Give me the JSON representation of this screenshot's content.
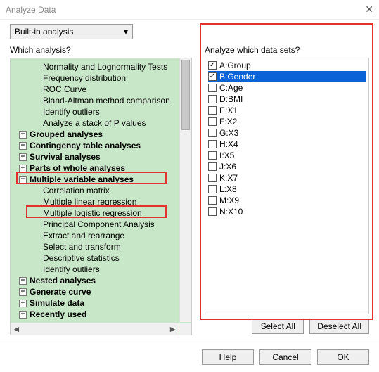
{
  "window": {
    "title": "Analyze Data"
  },
  "dropdown": {
    "value": "Built-in analysis"
  },
  "left": {
    "question": "Which analysis?",
    "tree": [
      {
        "indent": 1,
        "label": "Normality and Lognormality Tests"
      },
      {
        "indent": 1,
        "label": "Frequency distribution"
      },
      {
        "indent": 1,
        "label": "ROC Curve"
      },
      {
        "indent": 1,
        "label": "Bland-Altman method comparison"
      },
      {
        "indent": 1,
        "label": "Identify outliers"
      },
      {
        "indent": 1,
        "label": "Analyze a stack of P values"
      },
      {
        "indent": 0,
        "expander": "plus",
        "bold": true,
        "label": "Grouped analyses"
      },
      {
        "indent": 0,
        "expander": "plus",
        "bold": true,
        "label": "Contingency table analyses"
      },
      {
        "indent": 0,
        "expander": "plus",
        "bold": true,
        "label": "Survival analyses"
      },
      {
        "indent": 0,
        "expander": "plus",
        "bold": true,
        "label": "Parts of whole analyses"
      },
      {
        "indent": 0,
        "expander": "minus",
        "bold": true,
        "label": "Multiple variable analyses"
      },
      {
        "indent": 1,
        "label": "Correlation matrix"
      },
      {
        "indent": 1,
        "label": "Multiple linear regression"
      },
      {
        "indent": 1,
        "label": "Multiple logistic regression"
      },
      {
        "indent": 1,
        "label": "Principal Component Analysis"
      },
      {
        "indent": 1,
        "label": "Extract and rearrange"
      },
      {
        "indent": 1,
        "label": "Select and transform"
      },
      {
        "indent": 1,
        "label": "Descriptive statistics"
      },
      {
        "indent": 1,
        "label": "Identify outliers"
      },
      {
        "indent": 0,
        "expander": "plus",
        "bold": true,
        "label": "Nested analyses"
      },
      {
        "indent": 0,
        "expander": "plus",
        "bold": true,
        "label": "Generate curve"
      },
      {
        "indent": 0,
        "expander": "plus",
        "bold": true,
        "label": "Simulate data"
      },
      {
        "indent": 0,
        "expander": "plus",
        "bold": true,
        "label": "Recently used"
      }
    ]
  },
  "right": {
    "question": "Analyze which data sets?",
    "datasets": [
      {
        "label": "A:Group",
        "checked": true,
        "selected": false
      },
      {
        "label": "B:Gender",
        "checked": true,
        "selected": true
      },
      {
        "label": "C:Age",
        "checked": false,
        "selected": false
      },
      {
        "label": "D:BMI",
        "checked": false,
        "selected": false
      },
      {
        "label": "E:X1",
        "checked": false,
        "selected": false
      },
      {
        "label": "F:X2",
        "checked": false,
        "selected": false
      },
      {
        "label": "G:X3",
        "checked": false,
        "selected": false
      },
      {
        "label": "H:X4",
        "checked": false,
        "selected": false
      },
      {
        "label": "I:X5",
        "checked": false,
        "selected": false
      },
      {
        "label": "J:X6",
        "checked": false,
        "selected": false
      },
      {
        "label": "K:X7",
        "checked": false,
        "selected": false
      },
      {
        "label": "L:X8",
        "checked": false,
        "selected": false
      },
      {
        "label": "M:X9",
        "checked": false,
        "selected": false
      },
      {
        "label": "N:X10",
        "checked": false,
        "selected": false
      }
    ],
    "buttons": {
      "select_all": "Select All",
      "deselect_all": "Deselect All"
    }
  },
  "footer": {
    "help": "Help",
    "cancel": "Cancel",
    "ok": "OK"
  }
}
